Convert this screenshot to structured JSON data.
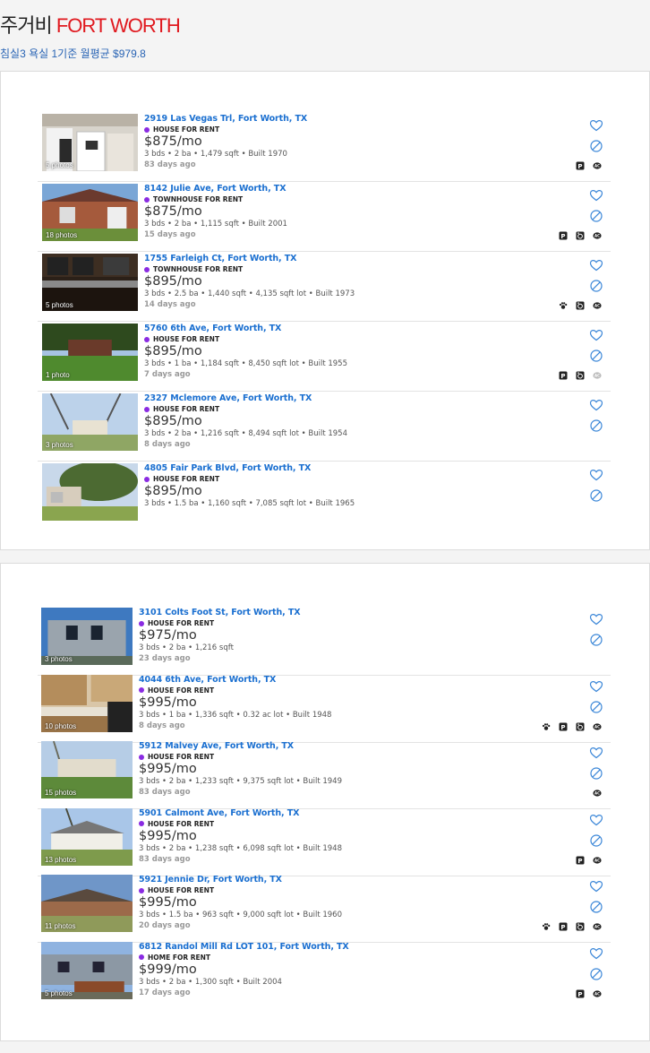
{
  "header": {
    "title_prefix": "주거비 ",
    "title_city": "FORT WORTH",
    "subtitle": "침실3 욕실 1기준 월평균 $979.8"
  },
  "cards": [
    {
      "listings": [
        {
          "address": "2919 Las Vegas Trl, Fort Worth, TX",
          "type": "HOUSE FOR RENT",
          "price": "$875/mo",
          "specs": "3 bds • 2 ba • 1,479 sqft • Built 1970",
          "ago": "83 days ago",
          "photos": "5 photos",
          "amenities": [
            "parking-icon",
            "ac-icon"
          ],
          "scene": "kitchen"
        },
        {
          "address": "8142 Julie Ave, Fort Worth, TX",
          "type": "TOWNHOUSE FOR RENT",
          "price": "$875/mo",
          "specs": "3 bds • 2 ba • 1,115 sqft • Built 2001",
          "ago": "15 days ago",
          "photos": "18 photos",
          "amenities": [
            "parking-icon",
            "laundry-icon",
            "ac-icon"
          ],
          "scene": "brick"
        },
        {
          "address": "1755 Farleigh Ct, Fort Worth, TX",
          "type": "TOWNHOUSE FOR RENT",
          "price": "$895/mo",
          "specs": "3 bds • 2.5 ba • 1,440 sqft • 4,135 sqft lot • Built 1973",
          "ago": "14 days ago",
          "photos": "5 photos",
          "amenities": [
            "pet-icon",
            "laundry-icon",
            "ac-icon"
          ],
          "scene": "darkkitchen"
        },
        {
          "address": "5760 6th Ave, Fort Worth, TX",
          "type": "HOUSE FOR RENT",
          "price": "$895/mo",
          "specs": "3 bds • 1 ba • 1,184 sqft • 8,450 sqft lot • Built 1955",
          "ago": "7 days ago",
          "photos": "1 photo",
          "amenities": [
            "parking-icon",
            "laundry-icon",
            "ac-off-icon"
          ],
          "scene": "yard"
        },
        {
          "address": "2327 Mclemore Ave, Fort Worth, TX",
          "type": "HOUSE FOR RENT",
          "price": "$895/mo",
          "specs": "3 bds • 2 ba • 1,216 sqft • 8,494 sqft lot • Built 1954",
          "ago": "8 days ago",
          "photos": "3 photos",
          "amenities": [],
          "scene": "tree"
        },
        {
          "address": "4805 Fair Park Blvd, Fort Worth, TX",
          "type": "HOUSE FOR RENT",
          "price": "$895/mo",
          "specs": "3 bds • 1.5 ba • 1,160 sqft • 7,085 sqft lot • Built 1965",
          "ago": "",
          "photos": "",
          "amenities": [],
          "scene": "ranch"
        }
      ]
    },
    {
      "listings": [
        {
          "address": "3101 Colts Foot St, Fort Worth, TX",
          "type": "HOUSE FOR RENT",
          "price": "$975/mo",
          "specs": "3 bds • 2 ba • 1,216 sqft",
          "ago": "23 days ago",
          "photos": "3 photos",
          "amenities": [],
          "scene": "mobile"
        },
        {
          "address": "4044 6th Ave, Fort Worth, TX",
          "type": "HOUSE FOR RENT",
          "price": "$995/mo",
          "specs": "3 bds • 1 ba • 1,336 sqft • 0.32 ac lot • Built 1948",
          "ago": "8 days ago",
          "photos": "10 photos",
          "amenities": [
            "pet-icon",
            "parking-icon",
            "laundry-icon",
            "ac-icon"
          ],
          "scene": "kitchen2"
        },
        {
          "address": "5912 Malvey Ave, Fort Worth, TX",
          "type": "HOUSE FOR RENT",
          "price": "$995/mo",
          "specs": "3 bds • 2 ba • 1,233 sqft • 9,375 sqft lot • Built 1949",
          "ago": "83 days ago",
          "photos": "15 photos",
          "amenities": [
            "ac-icon"
          ],
          "scene": "yard2"
        },
        {
          "address": "5901 Calmont Ave, Fort Worth, TX",
          "type": "HOUSE FOR RENT",
          "price": "$995/mo",
          "specs": "3 bds • 2 ba • 1,238 sqft • 6,098 sqft lot • Built 1948",
          "ago": "83 days ago",
          "photos": "13 photos",
          "amenities": [
            "parking-icon",
            "ac-icon"
          ],
          "scene": "white"
        },
        {
          "address": "5921 Jennie Dr, Fort Worth, TX",
          "type": "HOUSE FOR RENT",
          "price": "$995/mo",
          "specs": "3 bds • 1.5 ba • 963 sqft • 9,000 sqft lot • Built 1960",
          "ago": "20 days ago",
          "photos": "11 photos",
          "amenities": [
            "pet-icon",
            "parking-icon",
            "laundry-icon",
            "ac-icon"
          ],
          "scene": "brick2"
        },
        {
          "address": "6812 Randol Mill Rd LOT 101, Fort Worth, TX",
          "type": "HOME FOR RENT",
          "price": "$999/mo",
          "specs": "3 bds • 2 ba • 1,300 sqft • Built 2004",
          "ago": "17 days ago",
          "photos": "5 photos",
          "amenities": [
            "parking-icon",
            "ac-icon"
          ],
          "scene": "mobile2"
        }
      ]
    }
  ]
}
